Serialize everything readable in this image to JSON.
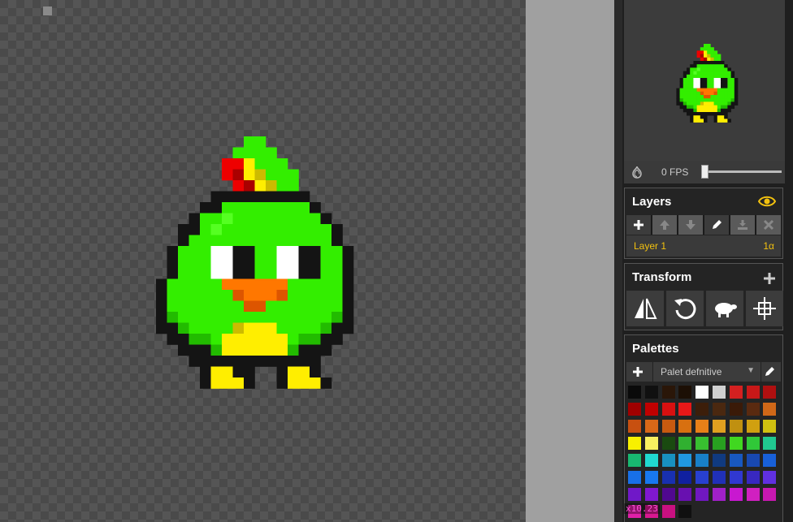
{
  "app": {
    "fps": {
      "label": "0 FPS",
      "value": 0
    }
  },
  "layers": {
    "title": "Layers",
    "items": [
      {
        "name": "Layer 1",
        "alpha": "1α"
      }
    ]
  },
  "transform": {
    "title": "Transform",
    "tools": [
      "flip-icon",
      "rotate-icon",
      "clone-sheep-icon",
      "center-icon"
    ]
  },
  "palettes": {
    "title": "Palettes",
    "selected": "Palet defnitive",
    "swatches": [
      "#0a0a0a",
      "#101010",
      "#2a1608",
      "#1c0f05",
      "#ffffff",
      "#d0d0d0",
      "#d42020",
      "#c81818",
      "#b01010",
      "#a00000",
      "#c00000",
      "#d81010",
      "#e81818",
      "#3c1e0a",
      "#4a2810",
      "#3a1a08",
      "#5a2a10",
      "#d06818",
      "#c85010",
      "#d86818",
      "#c85a10",
      "#d87010",
      "#e88018",
      "#e0a020",
      "#c09010",
      "#d0a010",
      "#d0c010",
      "#f8f000",
      "#f8f060",
      "#1a4a10",
      "#30b030",
      "#38c030",
      "#28a020",
      "#40d820",
      "#30c838",
      "#20c890",
      "#18b870",
      "#20d8d0",
      "#1890c0",
      "#2098e0",
      "#1880c8",
      "#103a80",
      "#1858c0",
      "#1848b0",
      "#1860d8",
      "#1870e8",
      "#1878f0",
      "#1830b0",
      "#1020a0",
      "#2840d0",
      "#2030b8",
      "#3038d0",
      "#3828c0",
      "#6030e0",
      "#7018c8",
      "#8018d0",
      "#500890",
      "#6810b0",
      "#7018c0",
      "#a020c8",
      "#c818d0",
      "#d020c0",
      "#c818b0",
      "#e020a8",
      "#d81890",
      "#c81080",
      "#101010"
    ]
  },
  "status": {
    "coords": "x10.23"
  }
}
